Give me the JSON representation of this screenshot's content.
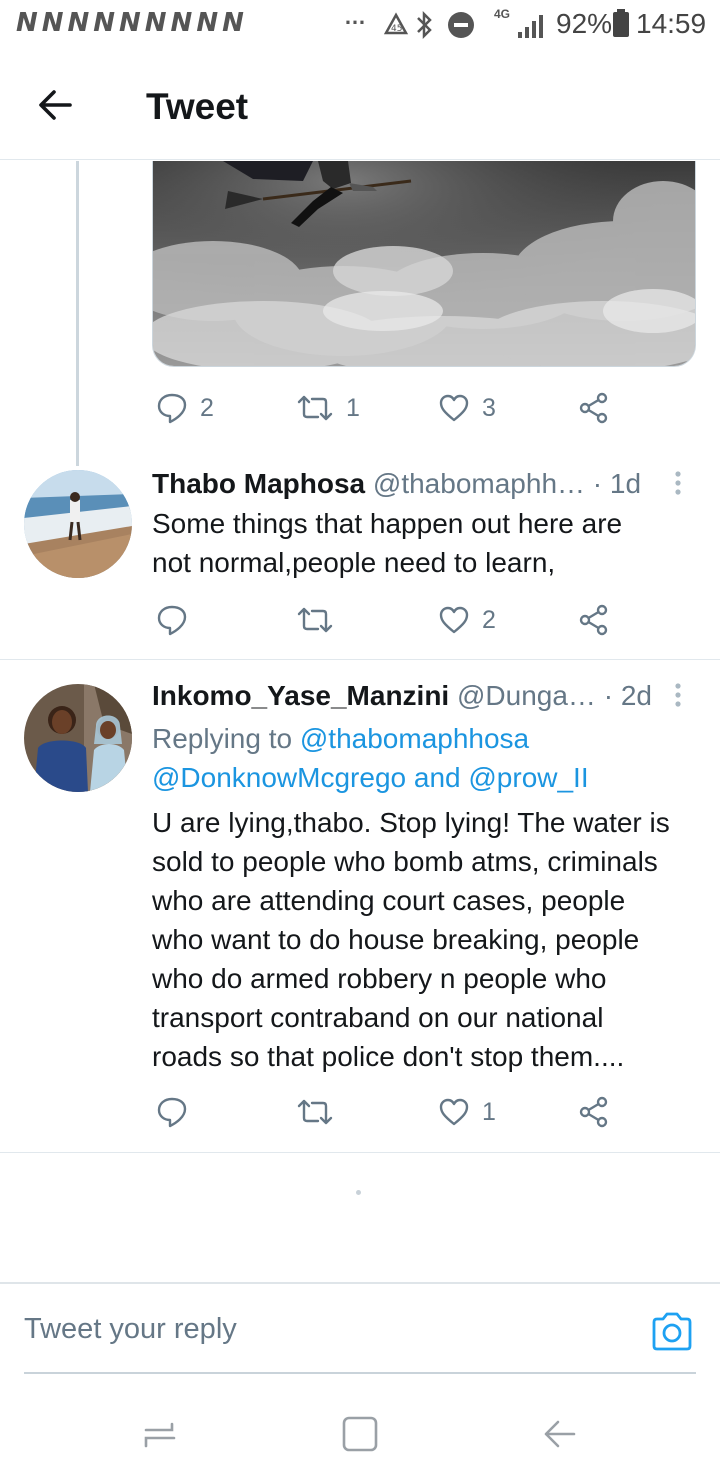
{
  "status_bar": {
    "notification_icons": "NNNNNNNNN",
    "more": "…",
    "network": "4G",
    "battery": "92%",
    "time": "14:59",
    "icons": [
      "recycle-icon",
      "bluetooth-icon",
      "dnd-icon",
      "network-4g-icon",
      "signal-icon",
      "battery-icon"
    ]
  },
  "header": {
    "title": "Tweet",
    "back_icon": "arrow-left-icon"
  },
  "first_tweet_actions": {
    "reply_count": "2",
    "retweet_count": "1",
    "like_count": "3"
  },
  "tweets": [
    {
      "name": "Thabo Maphosa",
      "handle": "@thabomaphh…",
      "time": "· 1d",
      "body_lines": [
        "Some things that happen out here are",
        "not normal,people need to learn,"
      ],
      "reply_count": "",
      "retweet_count": "",
      "like_count": "2"
    },
    {
      "name": "Inkomo_Yase_Manzini",
      "handle": "@Dunga…",
      "time": "· 2d",
      "replying_prefix": "Replying to",
      "mention_1": "@thabomaphhosa",
      "mention_2": "@DonknowMcgrego",
      "and_text": "and",
      "mention_3": "@prow_II",
      "body_lines": [
        "U are lying,thabo. Stop lying! The water is",
        "sold to people who bomb atms, criminals",
        "who are attending court cases, people",
        "who want to do house breaking, people",
        "who do armed robbery n people who",
        "transport contraband on our national",
        "roads so that police don't stop them...."
      ],
      "reply_count": "",
      "retweet_count": "",
      "like_count": "1"
    }
  ],
  "composer": {
    "placeholder": "Tweet your reply",
    "value": ""
  },
  "colors": {
    "accent": "#1da1f2",
    "text_primary": "#14171a",
    "text_secondary": "#657786",
    "divider": "#e1e8ed"
  }
}
